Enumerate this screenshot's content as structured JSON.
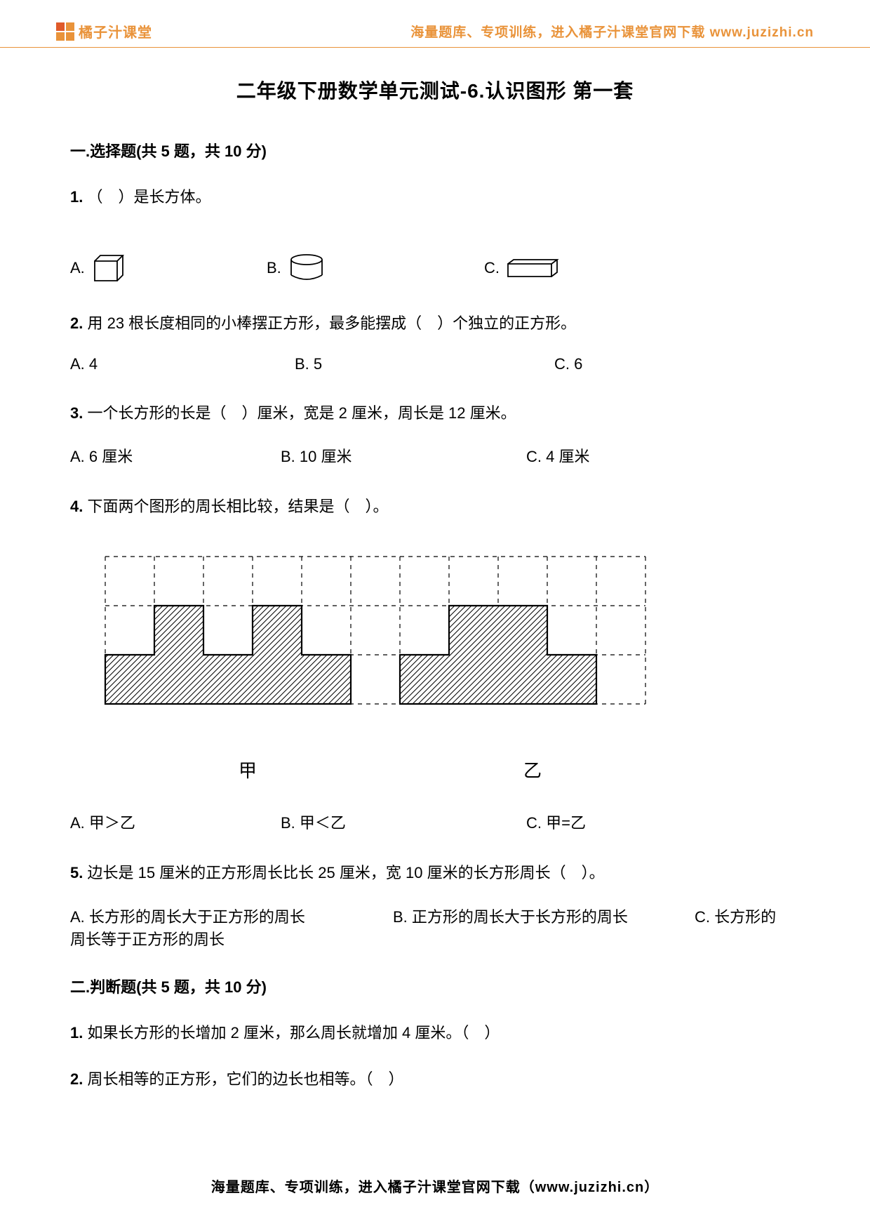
{
  "header": {
    "logo_text": "橘子汁课堂",
    "tagline": "海量题库、专项训练，进入橘子汁课堂官网下载 www.juzizhi.cn"
  },
  "page_title": "二年级下册数学单元测试-6.认识图形 第一套",
  "section1": {
    "title": "一.选择题(共 5 题，共 10 分)",
    "q1": {
      "num": "1.",
      "text": "（　）是长方体。",
      "a": "A.",
      "b": "B.",
      "c": "C."
    },
    "q2": {
      "num": "2.",
      "text": "用 23 根长度相同的小棒摆正方形，最多能摆成（　）个独立的正方形。",
      "a": "A. 4",
      "b": "B. 5",
      "c": "C. 6"
    },
    "q3": {
      "num": "3.",
      "text": "一个长方形的长是（　）厘米，宽是 2 厘米，周长是 12 厘米。",
      "a": "A. 6 厘米",
      "b": "B. 10 厘米",
      "c": "C. 4 厘米"
    },
    "q4": {
      "num": "4.",
      "text": "下面两个图形的周长相比较，结果是（　）。",
      "label_jia": "甲",
      "label_yi": "乙",
      "a": "A. 甲＞乙",
      "b": "B. 甲＜乙",
      "c": "C. 甲=乙"
    },
    "q5": {
      "num": "5.",
      "text": "边长是 15 厘米的正方形周长比长 25 厘米，宽 10 厘米的长方形周长（　）。",
      "a": "A. 长方形的周长大于正方形的周长",
      "b": "B. 正方形的周长大于长方形的周长",
      "c": "C. 长方形的",
      "c_cont": "周长等于正方形的周长"
    }
  },
  "section2": {
    "title": "二.判断题(共 5 题，共 10 分)",
    "q1": {
      "num": "1.",
      "text": "如果长方形的长增加 2 厘米，那么周长就增加 4 厘米。（　）"
    },
    "q2": {
      "num": "2.",
      "text": "周长相等的正方形，它们的边长也相等。（　）"
    }
  },
  "footer": "海量题库、专项训练，进入橘子汁课堂官网下载（www.juzizhi.cn）"
}
